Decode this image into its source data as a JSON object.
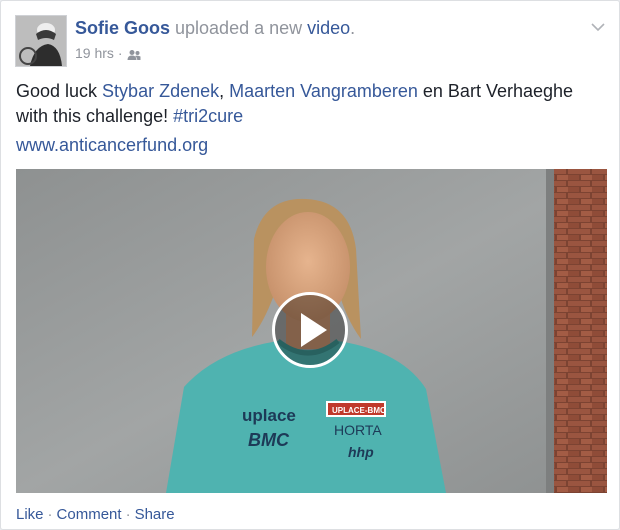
{
  "post": {
    "author": "Sofie Goos",
    "action_text": " uploaded a new ",
    "object_link": "video",
    "object_suffix": ".",
    "timestamp": "19 hrs",
    "meta_separator": "·",
    "audience_icon": "friends-icon",
    "options_icon": "chevron-down-icon",
    "text": {
      "prefix": "Good luck ",
      "mention_1": "Stybar Zdenek",
      "sep_1": ", ",
      "mention_2": "Maarten Vangramberen",
      "middle": " en Bart Verhaeghe with this challenge! ",
      "hashtag": "#tri2cure"
    },
    "url": "www.anticancerfund.org",
    "video": {
      "play_icon": "play-icon",
      "shirt_text_left": "uplace",
      "shirt_text_left_2": "BMC",
      "shirt_badge": "UPLACE-BMC",
      "shirt_text_right": "HORTA",
      "shirt_text_right_2": "hhp"
    },
    "actions": {
      "like": "Like",
      "comment": "Comment",
      "share": "Share",
      "separator": "·"
    }
  },
  "colors": {
    "link": "#365899",
    "meta": "#90949c",
    "text": "#1d2129",
    "shirt": "#4fb3b0",
    "wall": "#9b9e9e",
    "brick": "#8a4a35"
  }
}
